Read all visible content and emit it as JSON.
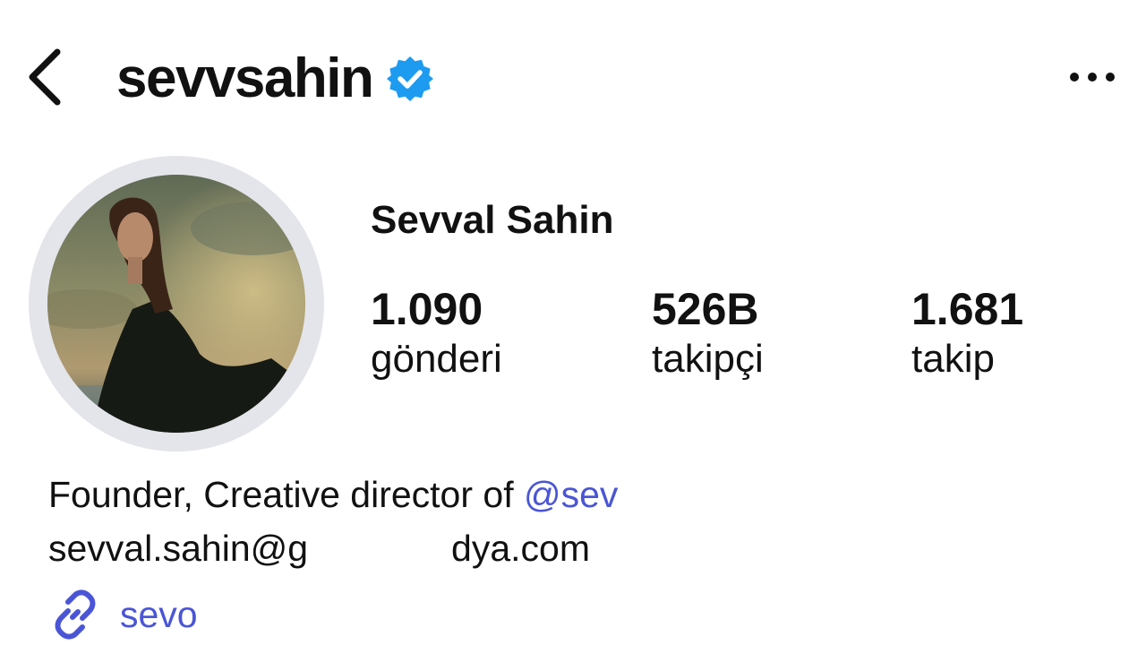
{
  "header": {
    "username": "sevvsahin",
    "verified": true,
    "icons": {
      "back": "chevron-left-icon",
      "verified": "verified-badge-icon",
      "more": "more-horizontal-icon"
    }
  },
  "profile": {
    "display_name": "Sevval Sahin",
    "stats": [
      {
        "value": "1.090",
        "label": "gönderi"
      },
      {
        "value": "526B",
        "label": "takipçi"
      },
      {
        "value": "1.681",
        "label": "takip"
      }
    ],
    "bio": {
      "line1_prefix": "Founder, Creative director of ",
      "line1_mention": "@sev",
      "line2_prefix": "sevval.sahin@g",
      "line2_suffix": "dya.com"
    },
    "link": {
      "text": "sevo",
      "icon": "link-icon"
    }
  },
  "colors": {
    "text": "#111111",
    "link": "#4a55d6",
    "verified_blue": "#1d9bf0",
    "avatar_ring": "#e4e5ea"
  }
}
